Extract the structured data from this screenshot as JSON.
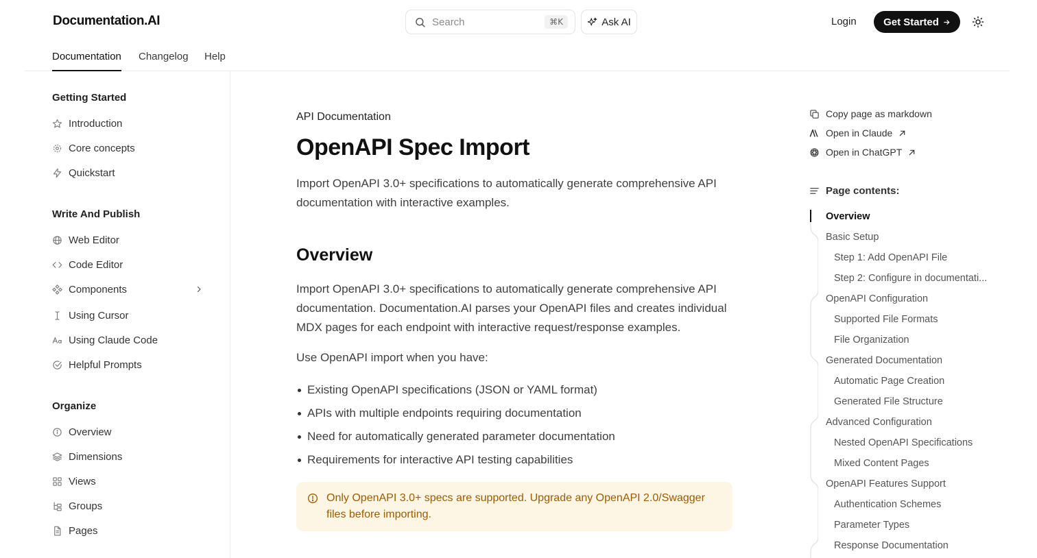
{
  "header": {
    "logo": "Documentation.AI",
    "search_placeholder": "Search",
    "search_shortcut": "⌘K",
    "ask_ai": "Ask AI",
    "login": "Login",
    "get_started": "Get Started"
  },
  "tabs": [
    {
      "label": "Documentation",
      "active": true
    },
    {
      "label": "Changelog"
    },
    {
      "label": "Help"
    }
  ],
  "sidebar": {
    "sections": [
      {
        "title": "Getting Started",
        "items": [
          {
            "label": "Introduction",
            "icon": "star-icon"
          },
          {
            "label": "Core concepts",
            "icon": "gear-icon"
          },
          {
            "label": "Quickstart",
            "icon": "bolt-icon"
          }
        ]
      },
      {
        "title": "Write And Publish",
        "items": [
          {
            "label": "Web Editor",
            "icon": "globe-icon"
          },
          {
            "label": "Code Editor",
            "icon": "code-icon"
          },
          {
            "label": "Components",
            "icon": "components-icon"
          },
          {
            "label": "Using Cursor",
            "icon": "text-cursor-icon"
          },
          {
            "label": "Using Claude Code",
            "icon": "font-icon"
          },
          {
            "label": "Helpful Prompts",
            "icon": "check-circle-icon"
          }
        ]
      },
      {
        "title": "Organize",
        "items": [
          {
            "label": "Overview",
            "icon": "info-icon"
          },
          {
            "label": "Dimensions",
            "icon": "layers-icon"
          },
          {
            "label": "Views",
            "icon": "grid-icon"
          },
          {
            "label": "Groups",
            "icon": "tree-icon"
          },
          {
            "label": "Pages",
            "icon": "file-icon"
          }
        ]
      }
    ]
  },
  "main": {
    "eyebrow": "API Documentation",
    "title": "OpenAPI Spec Import",
    "lead": "Import OpenAPI 3.0+ specifications to automatically generate comprehensive API documentation with interactive examples.",
    "overview_heading": "Overview",
    "overview_para": "Import OpenAPI 3.0+ specifications to automatically generate comprehensive API documentation. Documentation.AI parses your OpenAPI files and creates individual MDX pages for each endpoint with interactive request/response examples.",
    "use_when": "Use OpenAPI import when you have:",
    "bullets": [
      "Existing OpenAPI specifications (JSON or YAML format)",
      "APIs with multiple endpoints requiring documentation",
      "Need for automatically generated parameter documentation",
      "Requirements for interactive API testing capabilities"
    ],
    "callout": "Only OpenAPI 3.0+ specs are supported. Upgrade any OpenAPI 2.0/Swagger files before importing."
  },
  "page_actions": {
    "copy_markdown": "Copy page as markdown",
    "open_claude": "Open in Claude",
    "open_chatgpt": "Open in ChatGPT"
  },
  "toc": {
    "heading": "Page contents:",
    "items": [
      {
        "label": "Overview",
        "level": 1,
        "active": true
      },
      {
        "label": "Basic Setup",
        "level": 1
      },
      {
        "label": "Step 1: Add OpenAPI File",
        "level": 2
      },
      {
        "label": "Step 2: Configure in documentati...",
        "level": 2
      },
      {
        "label": "OpenAPI Configuration",
        "level": 1
      },
      {
        "label": "Supported File Formats",
        "level": 2
      },
      {
        "label": "File Organization",
        "level": 2
      },
      {
        "label": "Generated Documentation",
        "level": 1
      },
      {
        "label": "Automatic Page Creation",
        "level": 2
      },
      {
        "label": "Generated File Structure",
        "level": 2
      },
      {
        "label": "Advanced Configuration",
        "level": 1
      },
      {
        "label": "Nested OpenAPI Specifications",
        "level": 2
      },
      {
        "label": "Mixed Content Pages",
        "level": 2
      },
      {
        "label": "OpenAPI Features Support",
        "level": 1
      },
      {
        "label": "Authentication Schemes",
        "level": 2
      },
      {
        "label": "Parameter Types",
        "level": 2
      },
      {
        "label": "Response Documentation",
        "level": 2
      }
    ]
  },
  "colors": {
    "primary": "#111111",
    "callout_bg": "#fef6e4",
    "callout_text": "#9a5c00"
  }
}
